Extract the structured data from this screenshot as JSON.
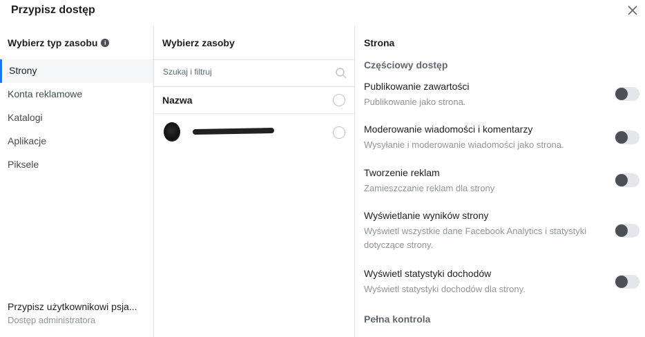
{
  "dialog": {
    "title": "Przypisz dostęp",
    "close_icon": "close-icon"
  },
  "left": {
    "heading": "Wybierz typ zasobu",
    "info_glyph": "i",
    "types": [
      {
        "label": "Strony",
        "active": true
      },
      {
        "label": "Konta reklamowe"
      },
      {
        "label": "Katalogi"
      },
      {
        "label": "Aplikacje"
      },
      {
        "label": "Piksele"
      }
    ],
    "footer_main": "Przypisz użytkownikowi psja...",
    "footer_sub": "Dostęp administratora"
  },
  "middle": {
    "heading": "Wybierz zasoby",
    "search_placeholder": "Szukaj i filtruj",
    "name_header": "Nazwa"
  },
  "right": {
    "section_title": "Strona",
    "partial_title": "Częściowy dostęp",
    "permissions": [
      {
        "name": "Publikowanie zawartości",
        "desc": "Publikowanie jako strona.",
        "enabled": false
      },
      {
        "name": "Moderowanie wiadomości i komentarzy",
        "desc": "Wysyłanie i moderowanie wiadomości jako strona.",
        "enabled": false
      },
      {
        "name": "Tworzenie reklam",
        "desc": "Zamieszczanie reklam dla strony",
        "enabled": false
      },
      {
        "name": "Wyświetlanie wyników strony",
        "desc": "Wyświetl wszystkie dane Facebook Analytics i statystyki dotyczące strony.",
        "enabled": false
      },
      {
        "name": "Wyświetl statystyki dochodów",
        "desc": "Wyświetl statystyki dochodów dla strony.",
        "enabled": false
      }
    ],
    "full_control_title": "Pełna kontrola"
  },
  "colors": {
    "accent": "#1877f2",
    "toggle_off": "#e4e6eb",
    "knob": "#4b4f56"
  }
}
